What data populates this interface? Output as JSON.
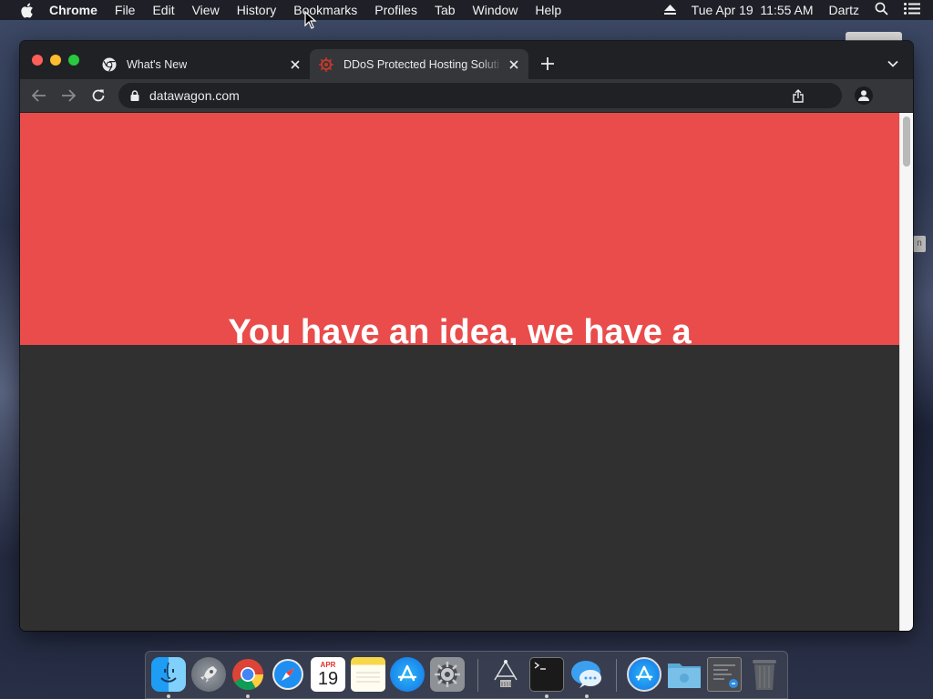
{
  "menubar": {
    "app_name": "Chrome",
    "items": [
      "File",
      "Edit",
      "View",
      "History",
      "Bookmarks",
      "Profiles",
      "Tab",
      "Window",
      "Help"
    ],
    "clock": "Tue Apr 19  11:55 AM",
    "user": "Dartz",
    "icons": [
      "apple-icon",
      "eject-icon",
      "spotlight-search-icon",
      "notification-list-icon"
    ]
  },
  "browser": {
    "tabs": [
      {
        "title": "What's New",
        "favicon": "chrome-icon",
        "active": false
      },
      {
        "title": "DDoS Protected Hosting Soluti",
        "favicon": "datawagon-icon",
        "active": true
      }
    ],
    "address": "datawagon.com"
  },
  "page": {
    "hero_heading": "You have an idea, we have a",
    "hero_color": "#ea4b4b",
    "section_color": "#303030"
  },
  "dock": {
    "apps": [
      "Finder",
      "Launchpad",
      "Google Chrome",
      "Safari",
      "Calendar",
      "Notes",
      "App Store",
      "System Preferences",
      "Network Radar",
      "Terminal",
      "Messages",
      "App Store Folder",
      "Downloads Folder",
      "Screenshot Stack",
      "Trash"
    ],
    "calendar": {
      "month": "APR",
      "day": "19"
    }
  }
}
